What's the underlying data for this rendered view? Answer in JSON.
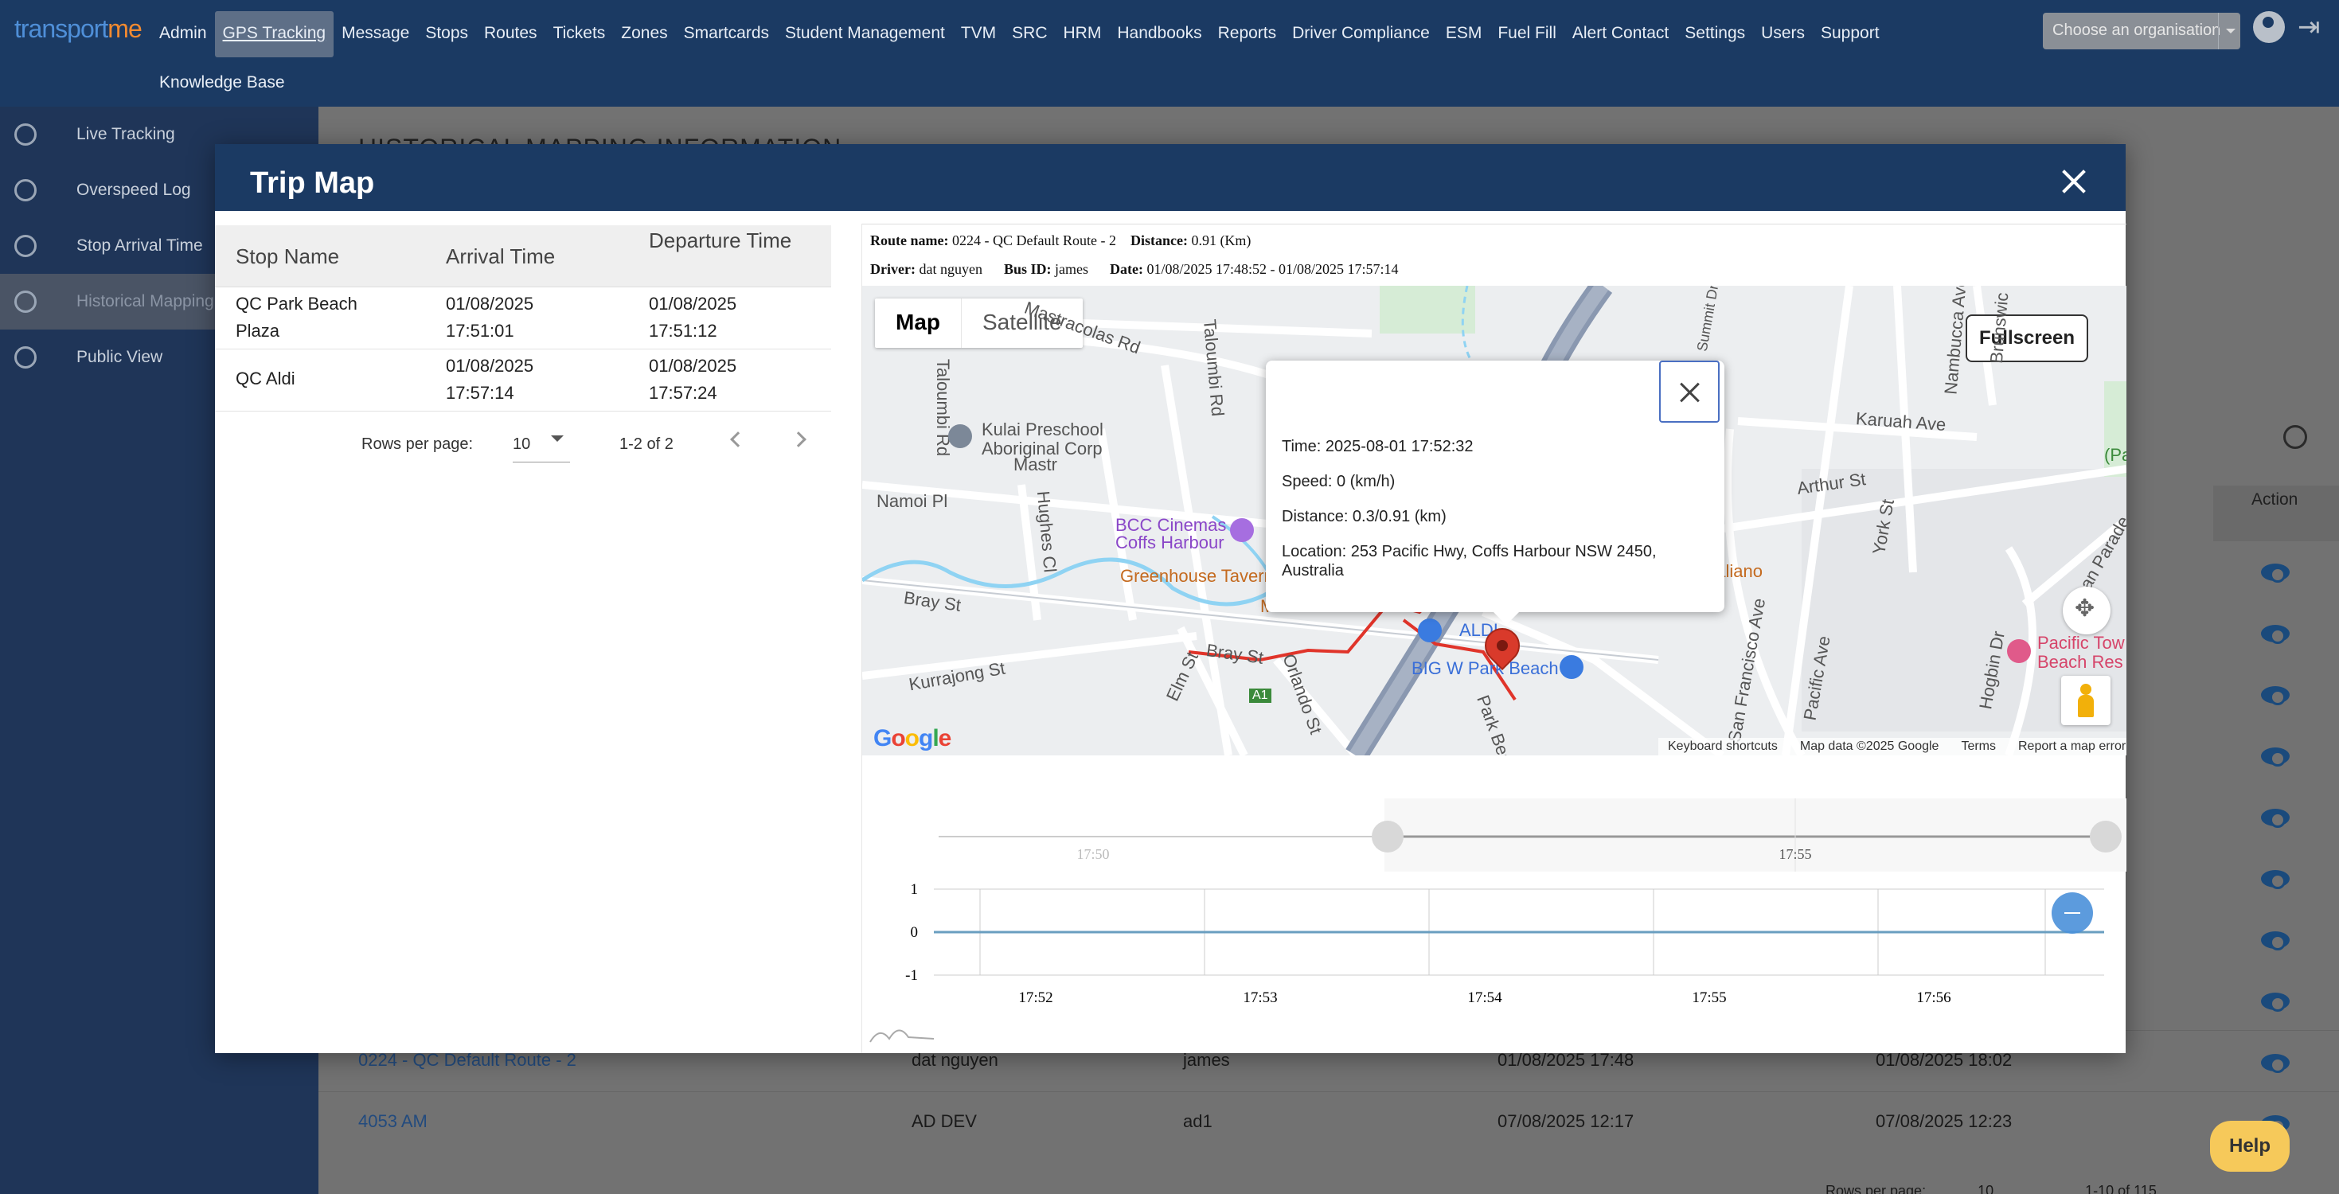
{
  "app": {
    "logo_part1": "transport",
    "logo_part2": "me"
  },
  "nav": {
    "row1": [
      "Admin",
      "GPS Tracking",
      "Message",
      "Stops",
      "Routes",
      "Tickets",
      "Zones",
      "Smartcards",
      "Student Management",
      "TVM",
      "SRC",
      "HRM",
      "Handbooks",
      "Reports",
      "Driver Compliance",
      "ESM",
      "Fuel Fill",
      "Alert Contact",
      "Settings",
      "Users",
      "Support"
    ],
    "row2": [
      "Knowledge Base"
    ],
    "active": "GPS Tracking",
    "org_placeholder": "Choose an organisation"
  },
  "sidebar": {
    "items": [
      {
        "label": "Live Tracking",
        "icon": "radar-icon"
      },
      {
        "label": "Overspeed Log",
        "icon": "speed-car-icon"
      },
      {
        "label": "Stop Arrival Time",
        "icon": "bus-icon"
      },
      {
        "label": "Historical Mapping",
        "icon": "route-map-icon"
      },
      {
        "label": "Public View",
        "icon": "globe-icon"
      }
    ],
    "active_index": 3
  },
  "background": {
    "title": "HISTORICAL MAPPING INFORMATION",
    "action_header": "Action",
    "rows": [
      {
        "route": "0224 - QC Default Route - 2",
        "driver": "dat nguyen",
        "bus": "james",
        "start": "01/08/2025 17:48",
        "end": "01/08/2025 18:02"
      },
      {
        "route": "4053 AM",
        "driver": "AD DEV",
        "bus": "ad1",
        "start": "07/08/2025 12:17",
        "end": "07/08/2025 12:23"
      }
    ],
    "footer_rows_label": "Rows per page:",
    "footer_rows_value": "10",
    "footer_range": "1-10 of 115"
  },
  "help": {
    "label": "Help"
  },
  "modal": {
    "title": "Trip Map",
    "stops": {
      "headers": {
        "name": "Stop Name",
        "arrival": "Arrival Time",
        "departure": "Departure Time"
      },
      "rows": [
        {
          "name_line1": "QC Park Beach",
          "name_line2": "Plaza",
          "arr_date": "01/08/2025",
          "arr_time": "17:51:01",
          "dep_date": "01/08/2025",
          "dep_time": "17:51:12"
        },
        {
          "name_line1": "QC Aldi",
          "name_line2": "",
          "arr_date": "01/08/2025",
          "arr_time": "17:57:14",
          "dep_date": "01/08/2025",
          "dep_time": "17:57:24"
        }
      ],
      "pager": {
        "rows_label": "Rows per page:",
        "rows_value": "10",
        "range": "1-2 of 2"
      }
    },
    "route_info": {
      "route_label": "Route name:",
      "route_value": "0224 - QC Default Route - 2",
      "distance_label": "Distance:",
      "distance_value": "0.91 (Km)",
      "driver_label": "Driver:",
      "driver_value": "dat nguyen",
      "bus_label": "Bus ID:",
      "bus_value": "james",
      "date_label": "Date:",
      "date_value": "01/08/2025 17:48:52 - 01/08/2025 17:57:14"
    },
    "map": {
      "type_map": "Map",
      "type_satellite": "Satellite",
      "fullscreen": "Fullscreen",
      "streets": {
        "mastracolas_rd": "Mastracolas Rd",
        "taloumbi_rd": "Taloumbi Rd",
        "taloumbi_rd2": "Taloumbi Rd",
        "namoi_pl": "Namoi Pl",
        "hughes_cl": "Hughes Cl",
        "bray_st": "Bray St",
        "bray_st2": "Bray St",
        "kurrajong_st": "Kurrajong St",
        "elm_st": "Elm St",
        "orlando_st": "Orlando St",
        "park_beach": "Park Beac",
        "arthur_st": "Arthur St",
        "karuah_ave": "Karuah Ave",
        "york_st": "York St",
        "hogbin_dr": "Hogbin Dr",
        "san_francisco_ave": "San Francisco Ave",
        "pacific_ave": "Pacific Ave",
        "nambucca_ave": "Nambucca Ave",
        "brunswick": "Brunswic",
        "summit_dr": "Summit Dr",
        "ocean_parade": "Ocean Parade",
        "mastr": "Mastr",
        "hwy_shield": "A1"
      },
      "pois": {
        "kulai_1": "Kulai Preschool",
        "kulai_2": "Aboriginal Corp",
        "bcc_1": "BCC Cinemas",
        "bcc_2": "Coffs Harbour",
        "greenhouse": "Greenhouse Tavern",
        "aldi": "ALDI",
        "big_w": "BIG W Park Beach",
        "italiano": "Italiano",
        "pacific_tower_1": "Pacific Tow",
        "pacific_tower_2": "Beach Res",
        "m_label": "M",
        "par_label": "(Par"
      },
      "footer": {
        "shortcuts": "Keyboard shortcuts",
        "data": "Map data ©2025 Google",
        "terms": "Terms",
        "report": "Report a map error"
      },
      "google": [
        "G",
        "o",
        "o",
        "g",
        "l",
        "e"
      ],
      "info": {
        "time": "Time: 2025-08-01 17:52:32",
        "speed": "Speed: 0 (km/h)",
        "distance": "Distance: 0.3/0.91 (km)",
        "location": "Location: 253 Pacific Hwy, Coffs Harbour NSW 2450, Australia"
      }
    }
  },
  "colors": {
    "navy": "#1b3a63",
    "accent_blue": "#4a90d9",
    "route_red": "#e0342a"
  },
  "chart_data": {
    "type": "line",
    "navigator_ticks": [
      "17:50",
      "17:55"
    ],
    "x_ticks": [
      "17:52",
      "17:53",
      "17:54",
      "17:55",
      "17:56"
    ],
    "y_ticks": [
      1,
      0,
      -1
    ],
    "ylim": [
      -1,
      1
    ],
    "series": [
      {
        "values": [
          0,
          0,
          0,
          0,
          0,
          0
        ]
      }
    ]
  }
}
